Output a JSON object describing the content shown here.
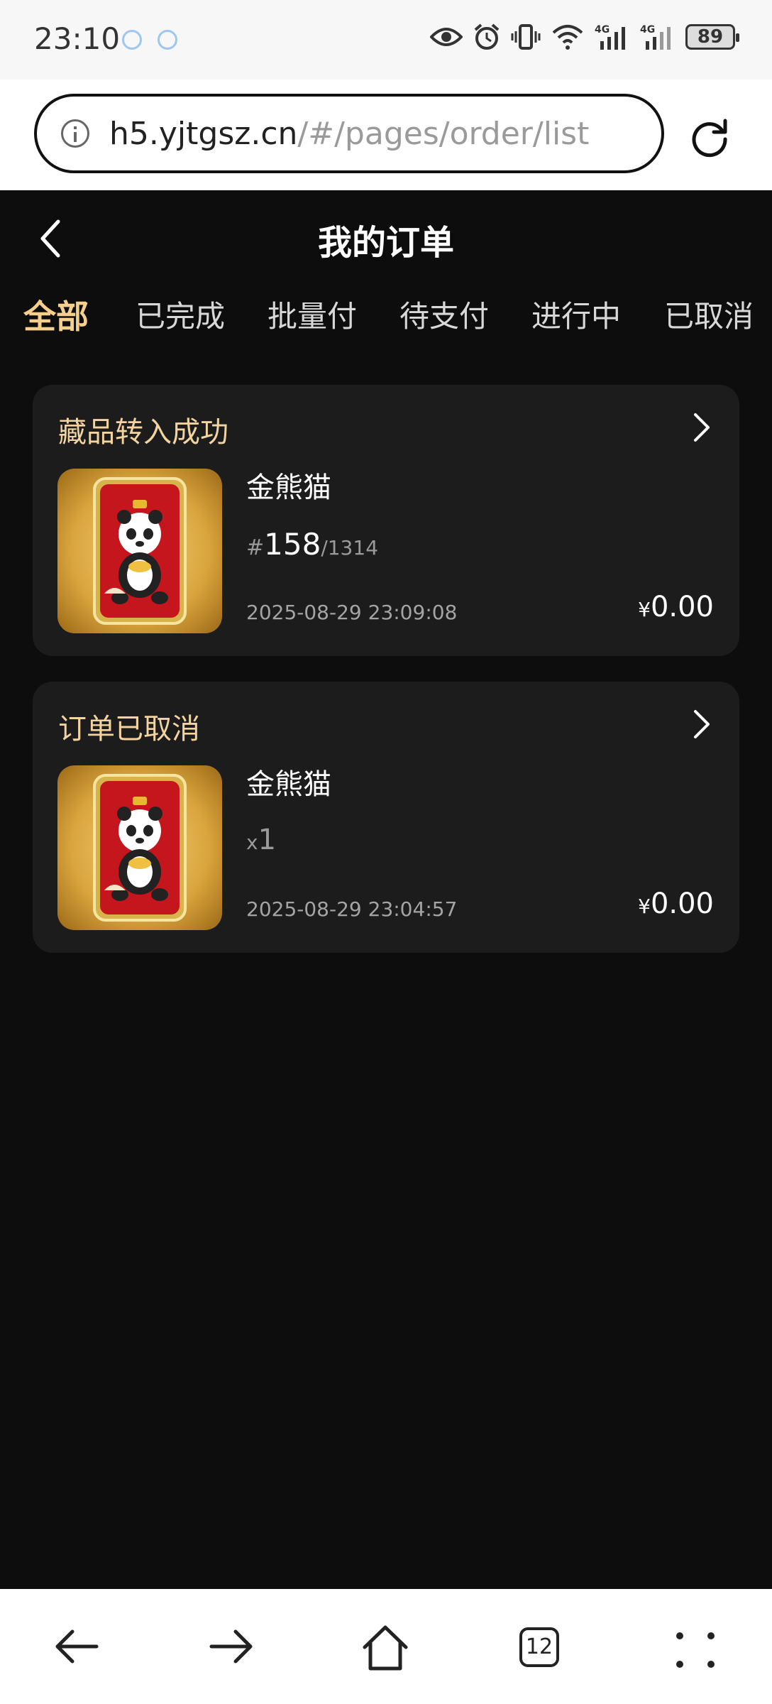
{
  "status_bar": {
    "time": "23:10",
    "battery": "89",
    "network_label": "4G"
  },
  "browser": {
    "url_host": "h5.yjtgsz.cn",
    "url_path": "/#/pages/order/list"
  },
  "page": {
    "title": "我的订单"
  },
  "tabs": [
    {
      "label": "全部",
      "active": true
    },
    {
      "label": "已完成",
      "active": false
    },
    {
      "label": "批量付",
      "active": false
    },
    {
      "label": "待支付",
      "active": false
    },
    {
      "label": "进行中",
      "active": false
    },
    {
      "label": "已取消",
      "active": false
    }
  ],
  "orders": [
    {
      "status": "藏品转入成功",
      "name": "金熊猫",
      "serial_hash": "#",
      "serial_number": "158",
      "serial_total": "/1314",
      "date": "2025-08-29 23:09:08",
      "currency": "¥",
      "price": "0.00"
    },
    {
      "status": "订单已取消",
      "name": "金熊猫",
      "qty_prefix": "x",
      "qty": "1",
      "date": "2025-08-29 23:04:57",
      "currency": "¥",
      "price": "0.00"
    }
  ],
  "bottom_nav": {
    "tab_count": "12"
  },
  "colors": {
    "accent": "#f5cf8c",
    "status_text": "#f3d3a0",
    "background": "#0d0d0d",
    "card": "#1c1c1c"
  }
}
